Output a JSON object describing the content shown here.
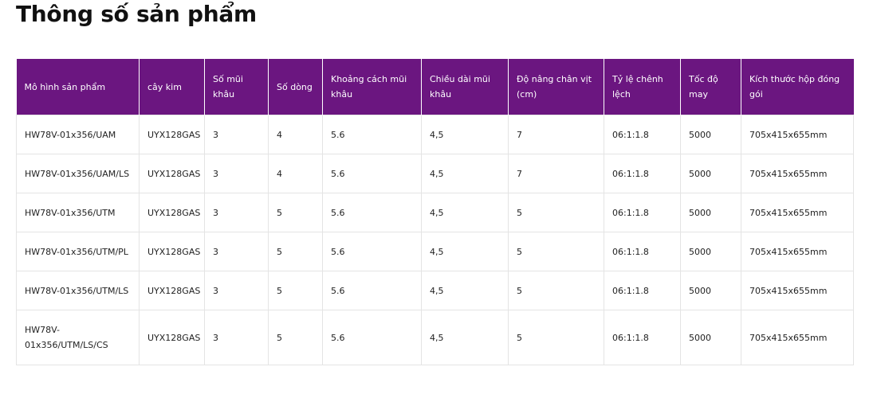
{
  "title": "Thông số sản phẩm",
  "theme": {
    "header_bg": "#6b1680",
    "header_text": "#ffffff",
    "border": "#e4e4e4"
  },
  "table": {
    "headers": [
      "Mô hình sản phẩm",
      "cây kim",
      "Số mũi khâu",
      "Số dòng",
      "Khoảng cách mũi khâu",
      "Chiều dài mũi khâu",
      "Độ nâng chân vịt (cm)",
      "Tỷ lệ chênh lệch",
      "Tốc độ may",
      "Kích thước hộp đóng gói"
    ],
    "rows": [
      [
        "HW78V-01x356/UAM",
        "UYX128GAS",
        "3",
        "4",
        "5.6",
        "4,5",
        "7",
        "06:1:1.8",
        "5000",
        "705x415x655mm"
      ],
      [
        "HW78V-01x356/UAM/LS",
        "UYX128GAS",
        "3",
        "4",
        "5.6",
        "4,5",
        "7",
        "06:1:1.8",
        "5000",
        "705x415x655mm"
      ],
      [
        "HW78V-01x356/UTM",
        "UYX128GAS",
        "3",
        "5",
        "5.6",
        "4,5",
        "5",
        "06:1:1.8",
        "5000",
        "705x415x655mm"
      ],
      [
        "HW78V-01x356/UTM/PL",
        "UYX128GAS",
        "3",
        "5",
        "5.6",
        "4,5",
        "5",
        "06:1:1.8",
        "5000",
        "705x415x655mm"
      ],
      [
        "HW78V-01x356/UTM/LS",
        "UYX128GAS",
        "3",
        "5",
        "5.6",
        "4,5",
        "5",
        "06:1:1.8",
        "5000",
        "705x415x655mm"
      ],
      [
        "HW78V-01x356/UTM/LS/CS",
        "UYX128GAS",
        "3",
        "5",
        "5.6",
        "4,5",
        "5",
        "06:1:1.8",
        "5000",
        "705x415x655mm"
      ]
    ]
  }
}
